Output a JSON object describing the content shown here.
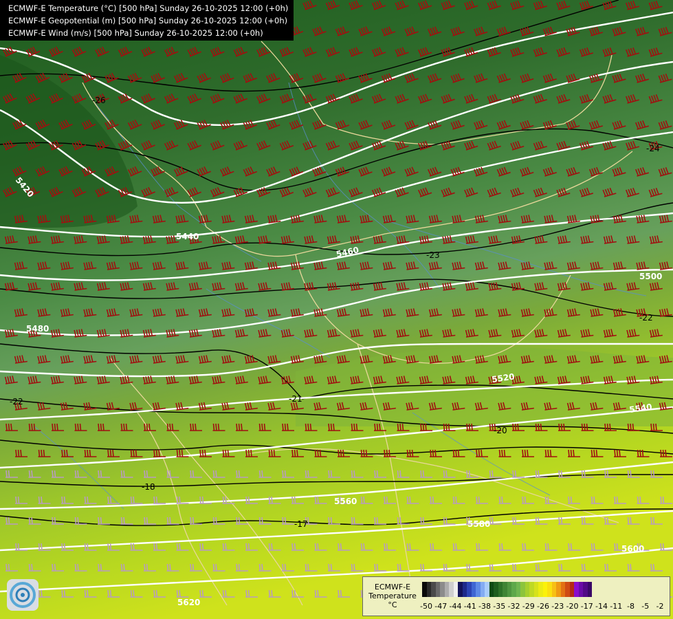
{
  "titles": [
    "ECMWF-E Temperature (°C) [500 hPa] Sunday 26-10-2025 12:00 (+0h)",
    "ECMWF-E Geopotential (m) [500 hPa] Sunday 26-10-2025 12:00 (+0h)",
    "ECMWF-E Wind (m/s) [500 hPa] Sunday 26-10-2025 12:00 (+0h)"
  ],
  "colorbar": {
    "model": "ECMWF-E",
    "variable": "Temperature",
    "unit": "°C",
    "tick_labels": [
      "-50",
      "-47",
      "-44",
      "-41",
      "-38",
      "-35",
      "-32",
      "-29",
      "-26",
      "-23",
      "-20",
      "-17",
      "-14",
      "-11",
      "-8",
      "-5",
      "-2"
    ],
    "colors": [
      "#0a0a0a",
      "#2a2a2a",
      "#4a4a4a",
      "#6a6a6a",
      "#8c8c8c",
      "#adadad",
      "#cfcfcf",
      "#efefef",
      "#14145a",
      "#1e2a8a",
      "#2c44b4",
      "#3f66d2",
      "#5e8ae6",
      "#84acf2",
      "#aacdfb",
      "#0f4a14",
      "#1e5e1e",
      "#2e7228",
      "#3f8434",
      "#4f9640",
      "#5ea84a",
      "#6fb650",
      "#8cc43c",
      "#a6cf2e",
      "#bfd924",
      "#d6e21c",
      "#ecec14",
      "#fbf20a",
      "#fbe010",
      "#f7c014",
      "#ef9a14",
      "#e27214",
      "#cf4c14",
      "#b42a14",
      "#8a0ccc",
      "#6a0ca6",
      "#520a86",
      "#3a0866"
    ]
  },
  "geopotential_labels": [
    "5420",
    "5440",
    "5460",
    "5480",
    "5500",
    "5520",
    "5540",
    "5560",
    "5580",
    "5600",
    "5620"
  ],
  "temperature_labels": [
    "-26",
    "-24",
    "-23",
    "-22",
    "-21",
    "-20",
    "-18",
    "-17"
  ],
  "colors": {
    "geopotential_contour": "#ffffff",
    "temperature_contour": "#000000",
    "wind_barb_strong": "#a01010",
    "wind_barb_weak": "#b89cbf",
    "borders": "#e8d79a",
    "rivers": "#5a8fd0"
  }
}
